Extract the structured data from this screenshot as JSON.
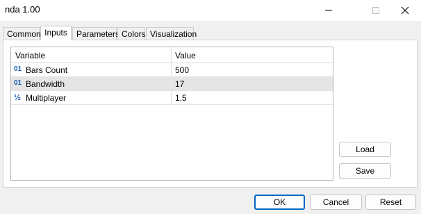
{
  "window": {
    "title": "nda 1.00"
  },
  "tabs": [
    {
      "label": "Common"
    },
    {
      "label": "Inputs"
    },
    {
      "label": "Parameters"
    },
    {
      "label": "Colors"
    },
    {
      "label": "Visualization"
    }
  ],
  "active_tab": "Inputs",
  "grid": {
    "columns": [
      "Variable",
      "Value"
    ],
    "rows": [
      {
        "icon": "integer-type-icon",
        "type_glyph": "01",
        "name": "Bars Count",
        "value": "500"
      },
      {
        "icon": "integer-type-icon",
        "type_glyph": "01",
        "name": "Bandwidth",
        "value": "17"
      },
      {
        "icon": "double-type-icon",
        "type_glyph": "½",
        "name": "Multiplayer",
        "value": "1.5"
      }
    ]
  },
  "side_buttons": {
    "load": "Load",
    "save": "Save"
  },
  "footer": {
    "ok": "OK",
    "cancel": "Cancel",
    "reset": "Reset"
  },
  "colors": {
    "ok_border": "#0067c0",
    "selected_row": "#e5e5e5",
    "type_icon": "#1a5fb4"
  }
}
